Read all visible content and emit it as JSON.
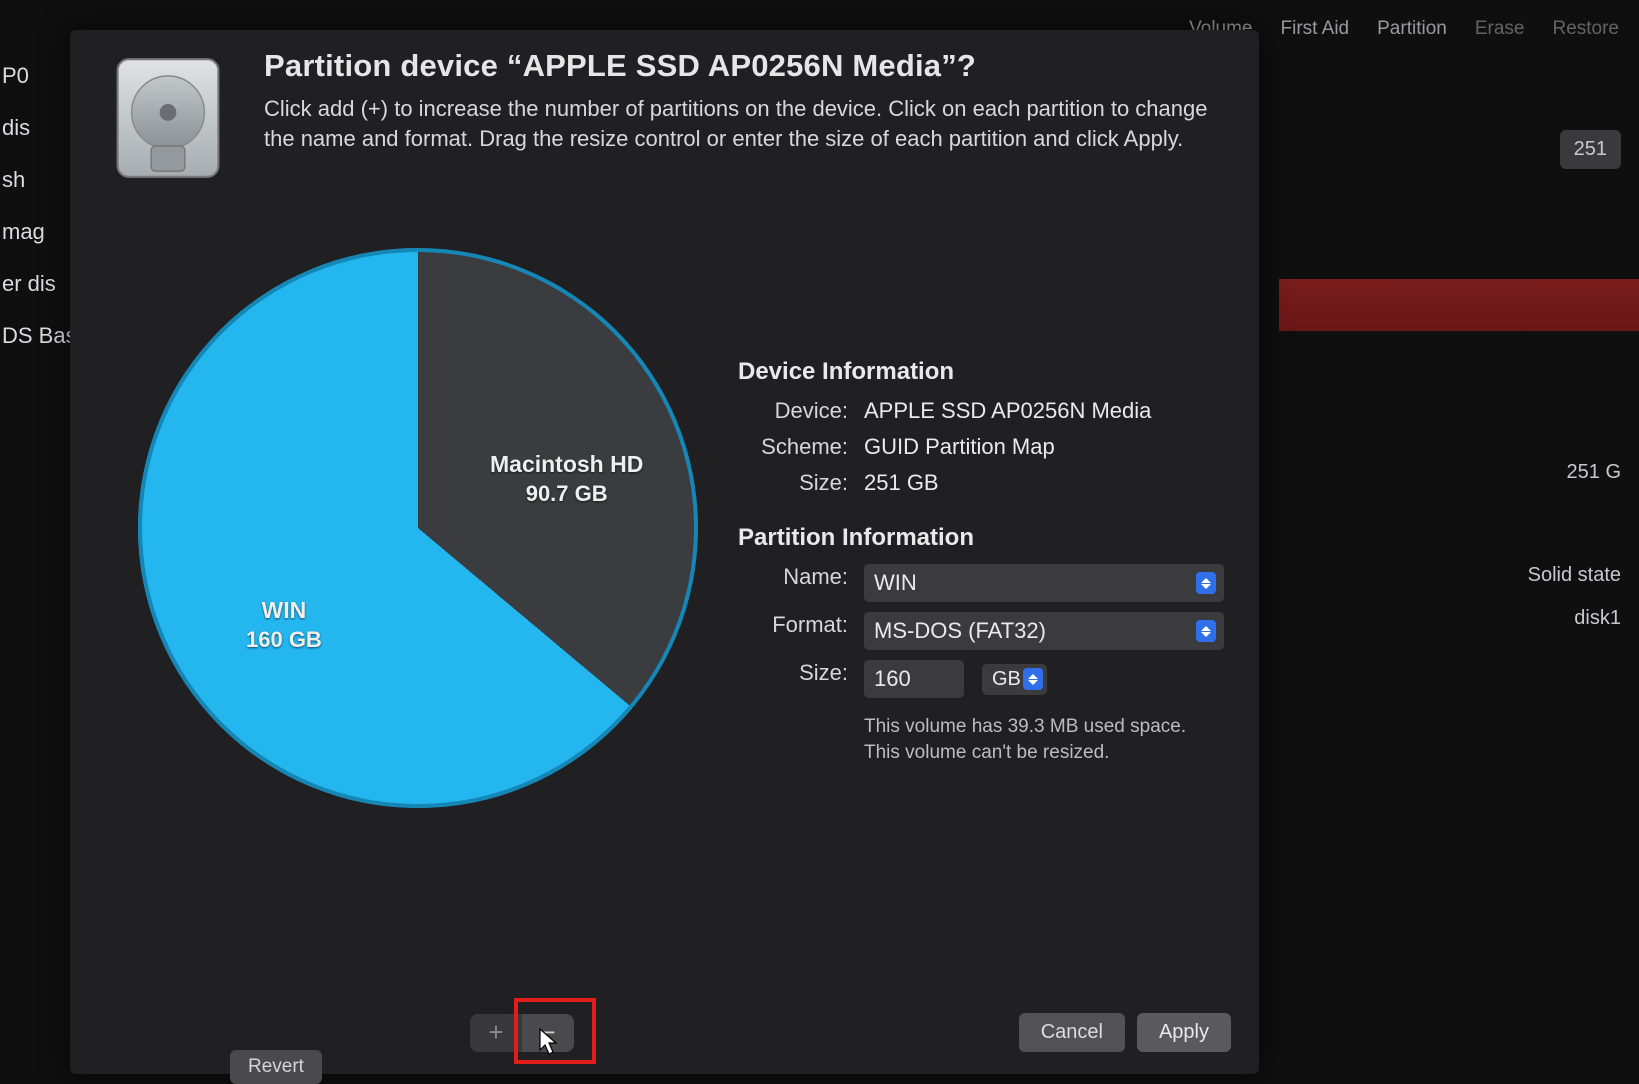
{
  "bg_toolbar": {
    "items": [
      "Volume",
      "First Aid",
      "Partition",
      "Erase",
      "Restore"
    ]
  },
  "bg_left": {
    "items": [
      "P0",
      "dis",
      "sh",
      "",
      "mag",
      "er dis",
      "DS Bas"
    ]
  },
  "bg_right": {
    "size_label": "251",
    "row1": "251 G",
    "row2": "Solid state",
    "row3": "disk1"
  },
  "header": {
    "title": "Partition device “APPLE SSD AP0256N Media”?",
    "subtitle": "Click add (+) to increase the number of partitions on the device. Click on each partition to change the name and format. Drag the resize control or enter the size of each partition and click Apply."
  },
  "chart_data": {
    "type": "pie",
    "title": "",
    "series": [
      {
        "name": "Macintosh HD",
        "value_gb": 90.7,
        "label": "Macintosh HD",
        "sublabel": "90.7 GB",
        "color": "#3a3c3f"
      },
      {
        "name": "WIN",
        "value_gb": 160,
        "label": "WIN",
        "sublabel": "160 GB",
        "color": "#24b7ef"
      }
    ],
    "total_gb": 251
  },
  "device_info": {
    "heading": "Device Information",
    "device_k": "Device:",
    "device_v": "APPLE SSD AP0256N Media",
    "scheme_k": "Scheme:",
    "scheme_v": "GUID Partition Map",
    "size_k": "Size:",
    "size_v": "251 GB"
  },
  "partition_info": {
    "heading": "Partition Information",
    "name_k": "Name:",
    "name_v": "WIN",
    "format_k": "Format:",
    "format_v": "MS-DOS (FAT32)",
    "size_k": "Size:",
    "size_v": "160",
    "unit": "GB",
    "hint1": "This volume has 39.3 MB used space.",
    "hint2": "This volume can't be resized."
  },
  "buttons": {
    "add": "+",
    "remove": "−",
    "cancel": "Cancel",
    "apply": "Apply",
    "revert": "Revert"
  }
}
